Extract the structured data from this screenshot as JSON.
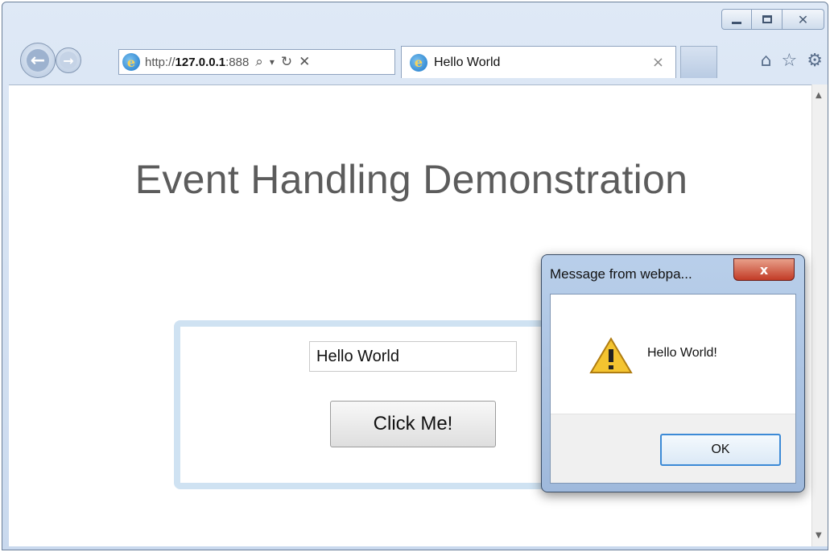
{
  "browser": {
    "address": {
      "url_prefix": "http://",
      "url_host": "127.0.0.1",
      "url_port": ":888",
      "search_glyph": "⌕",
      "dropdown_glyph": "▾",
      "refresh_glyph": "↻",
      "stop_glyph": "✕"
    },
    "tab": {
      "title": "Hello World",
      "close_glyph": "×"
    },
    "window_controls": {
      "close_glyph": "✕"
    },
    "command_icons": {
      "home": "⌂",
      "favorites": "☆",
      "tools": "⚙"
    },
    "nav": {
      "back_glyph": "←",
      "forward_glyph": "→"
    }
  },
  "page": {
    "heading": "Event Handling Demonstration",
    "input_value": "Hello World",
    "button_label": "Click Me!"
  },
  "dialog": {
    "title": "Message from webpa...",
    "close_glyph": "x",
    "message": "Hello World!",
    "ok_label": "OK"
  }
}
